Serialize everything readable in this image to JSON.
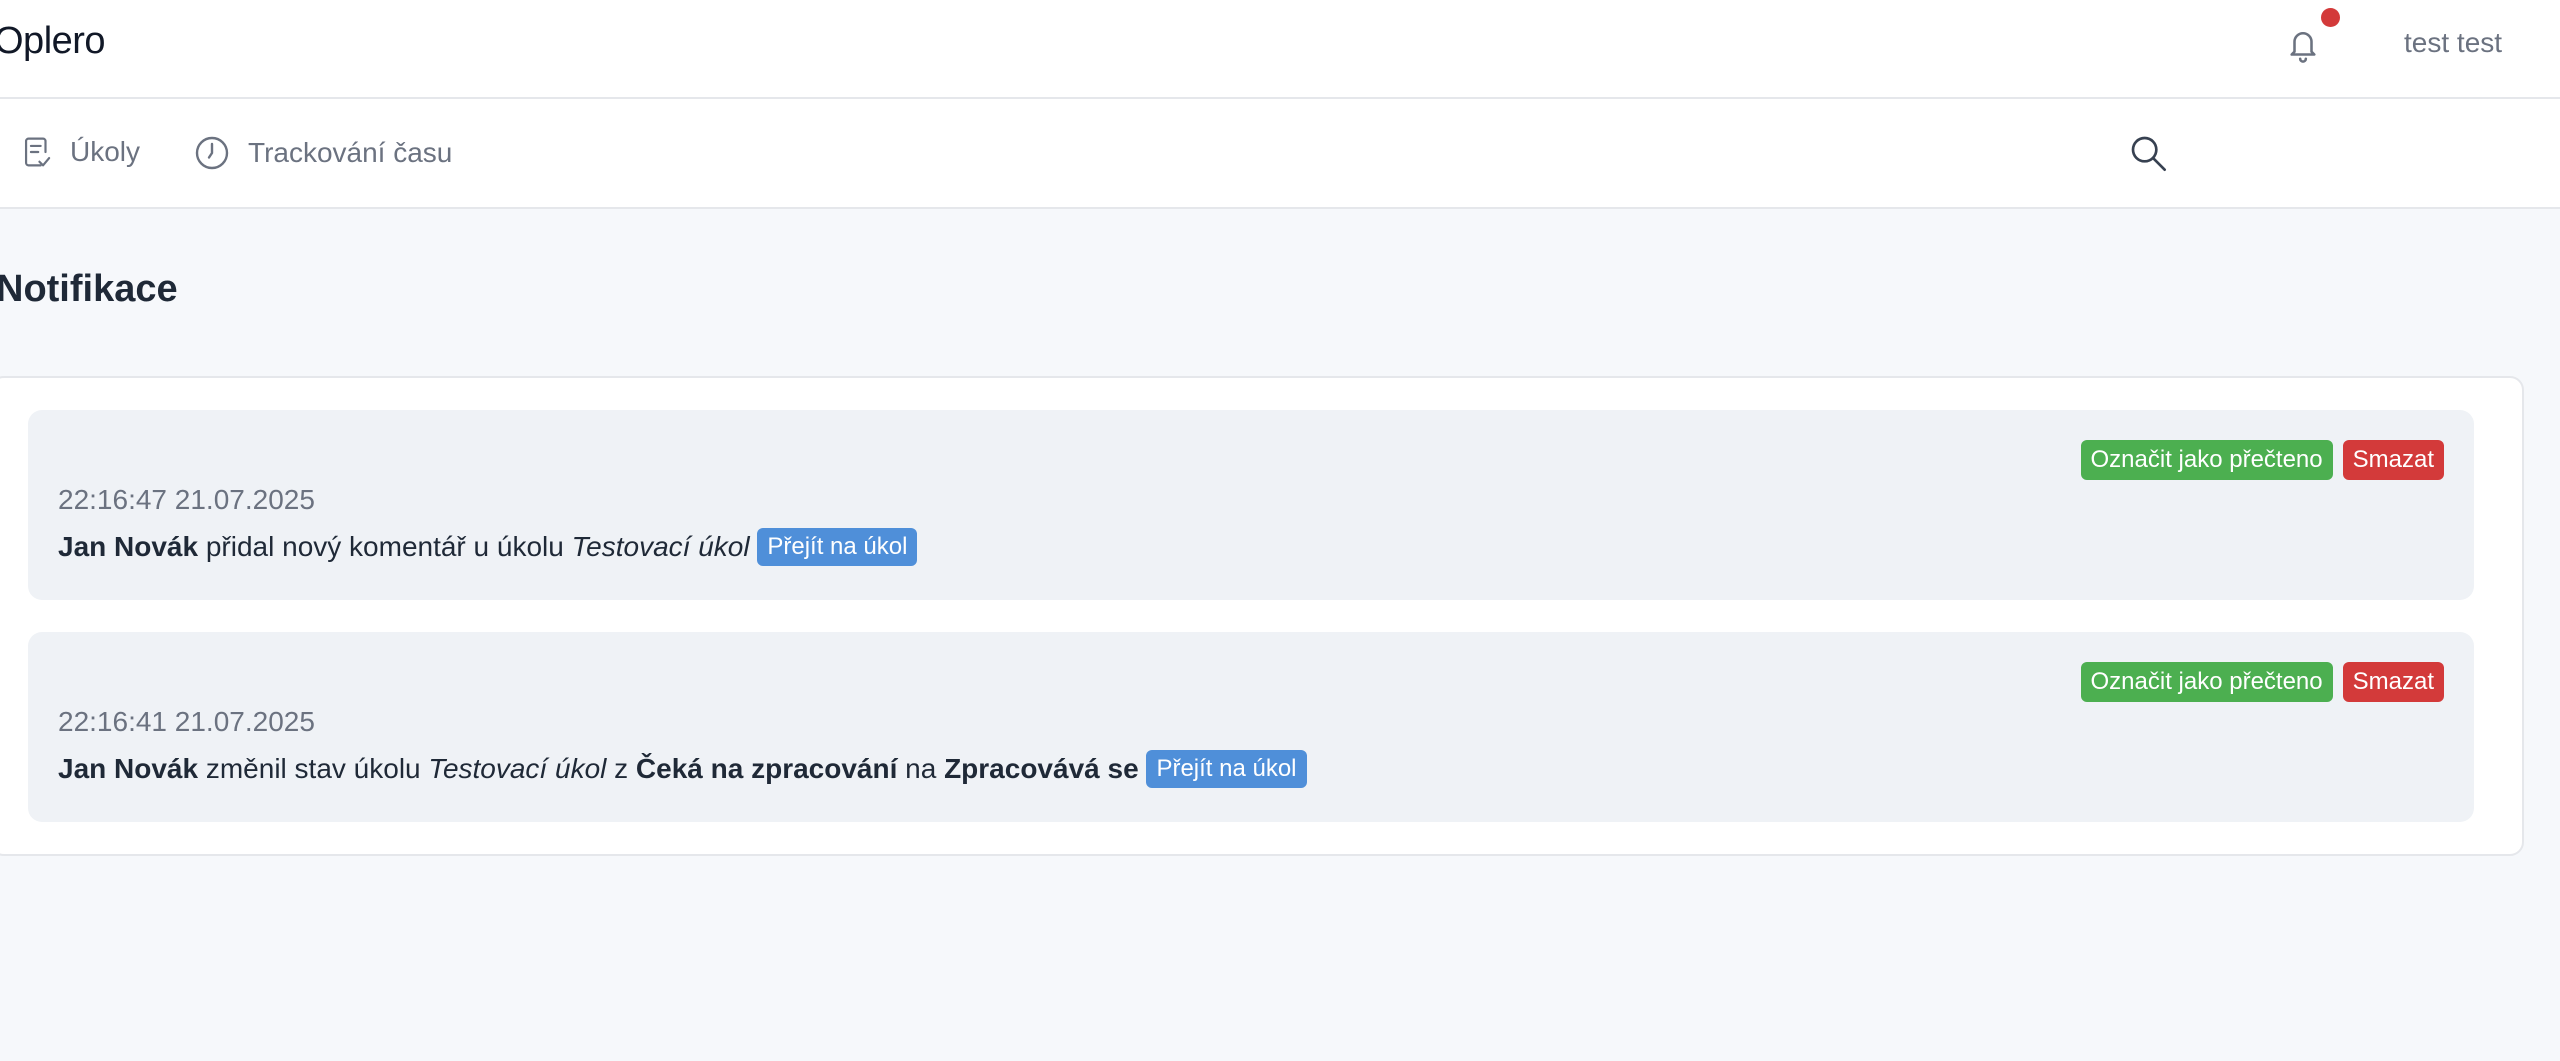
{
  "app": {
    "brand": "Oplero",
    "user_name": "test test",
    "notification_dot_color": "#d33a3a"
  },
  "nav": {
    "items": [
      {
        "label": "Úkoly",
        "icon": "tasks-icon"
      },
      {
        "label": "Trackování času",
        "icon": "clock-icon"
      }
    ],
    "search_icon": "search-icon"
  },
  "page": {
    "title": "Notifikace"
  },
  "notifications": [
    {
      "time": "22:16:47 21.07.2025",
      "actor": "Jan Novák",
      "text_1": " přidal nový komentář u úkolu ",
      "task": "Testovací úkol",
      "mark_read_label": "Označit jako přečteno",
      "delete_label": "Smazat",
      "goto_label": "Přejít na úkol"
    },
    {
      "time": "22:16:41 21.07.2025",
      "actor": "Jan Novák",
      "text_1": " změnil stav úkolu ",
      "task": "Testovací úkol",
      "text_2": " z ",
      "from_state": "Čeká na zpracování",
      "text_3": " na ",
      "to_state": "Zpracovává se",
      "mark_read_label": "Označit jako přečteno",
      "delete_label": "Smazat",
      "goto_label": "Přejít na úkol"
    }
  ],
  "colors": {
    "success": "#4caf50",
    "danger": "#d33a3a",
    "primary": "#4f8fd9"
  }
}
